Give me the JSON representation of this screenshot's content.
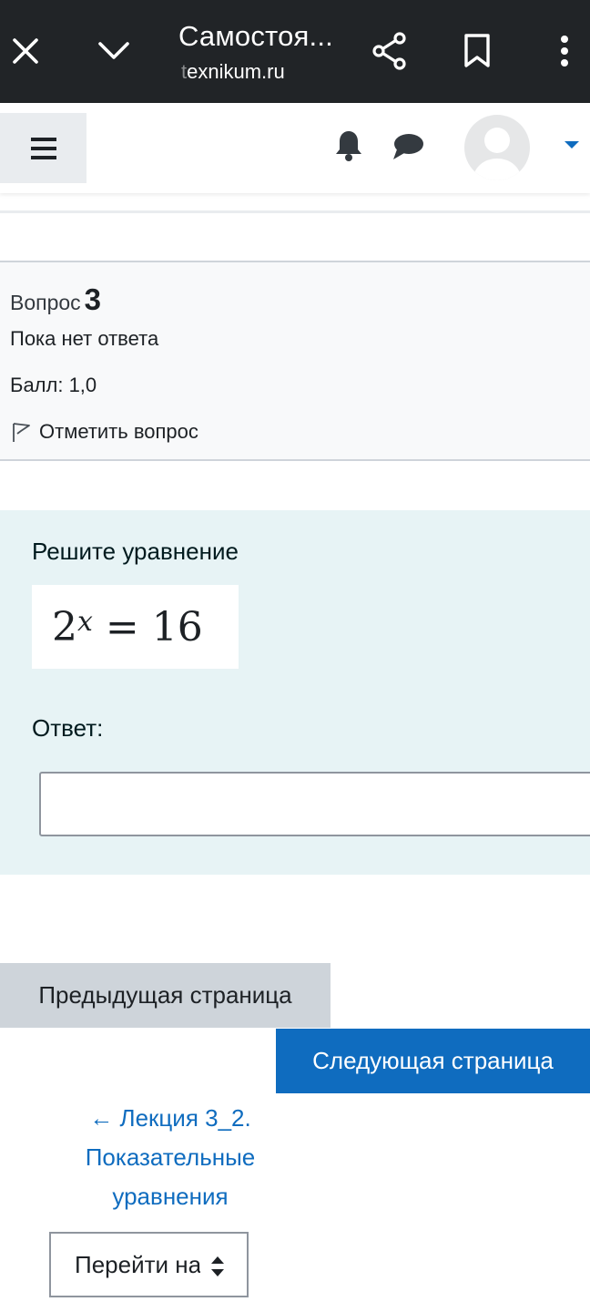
{
  "browser": {
    "title": "Самостоя...",
    "url_faded": "t",
    "url_rest": "exnikum.ru",
    "icons": [
      "close-icon",
      "chevron-down-icon",
      "share-icon",
      "bookmark-icon",
      "more-vert-icon"
    ]
  },
  "nav": {
    "icons": [
      "menu-icon",
      "bell-icon",
      "chat-icon",
      "user-avatar",
      "caret-down-icon"
    ]
  },
  "question_info": {
    "label": "Вопрос",
    "number": "3",
    "state": "Пока нет ответа",
    "grade": "Балл: 1,0",
    "flag_label": "Отметить вопрос"
  },
  "formulation": {
    "prompt": "Решите уравнение",
    "equation_base": "2",
    "equation_exponent": "x",
    "equation_rest": " = 16",
    "answer_label": "Ответ:",
    "answer_value": ""
  },
  "navigation": {
    "prev_label": "Предыдущая страница",
    "next_label": "Следующая страница",
    "prev_activity_arrow": "←",
    "prev_activity": "Лекция 3_2. Показательные уравнения",
    "jump_select": "Перейти на..."
  },
  "colors": {
    "browser_bar": "#212427",
    "primary": "#0f6cbf",
    "secondary_btn": "#ced4da",
    "formulation_bg": "#e7f3f5",
    "info_bg": "#f8f9fa"
  }
}
